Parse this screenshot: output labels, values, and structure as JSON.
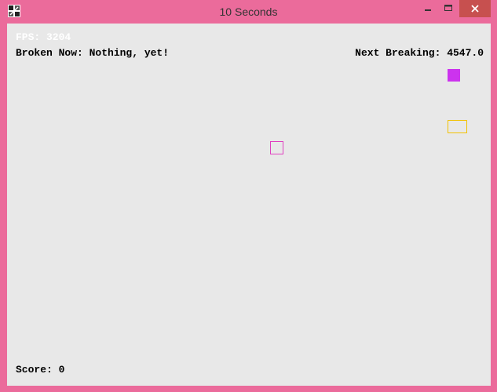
{
  "window": {
    "title": "10 Seconds",
    "colors": {
      "frame": "#eb6b9b",
      "close": "#c7504f",
      "canvas": "#e8e8e8"
    }
  },
  "hud": {
    "fps_label": "FPS: 3204",
    "broken_label": "Broken Now: Nothing, yet!",
    "next_label": "Next Breaking: 4547.0",
    "score_key": "Score:",
    "score_value": "0"
  },
  "blocks": {
    "player_color": "#e040c0",
    "magenta_color": "#cc33ee",
    "yellow_color": "#f2c200"
  }
}
